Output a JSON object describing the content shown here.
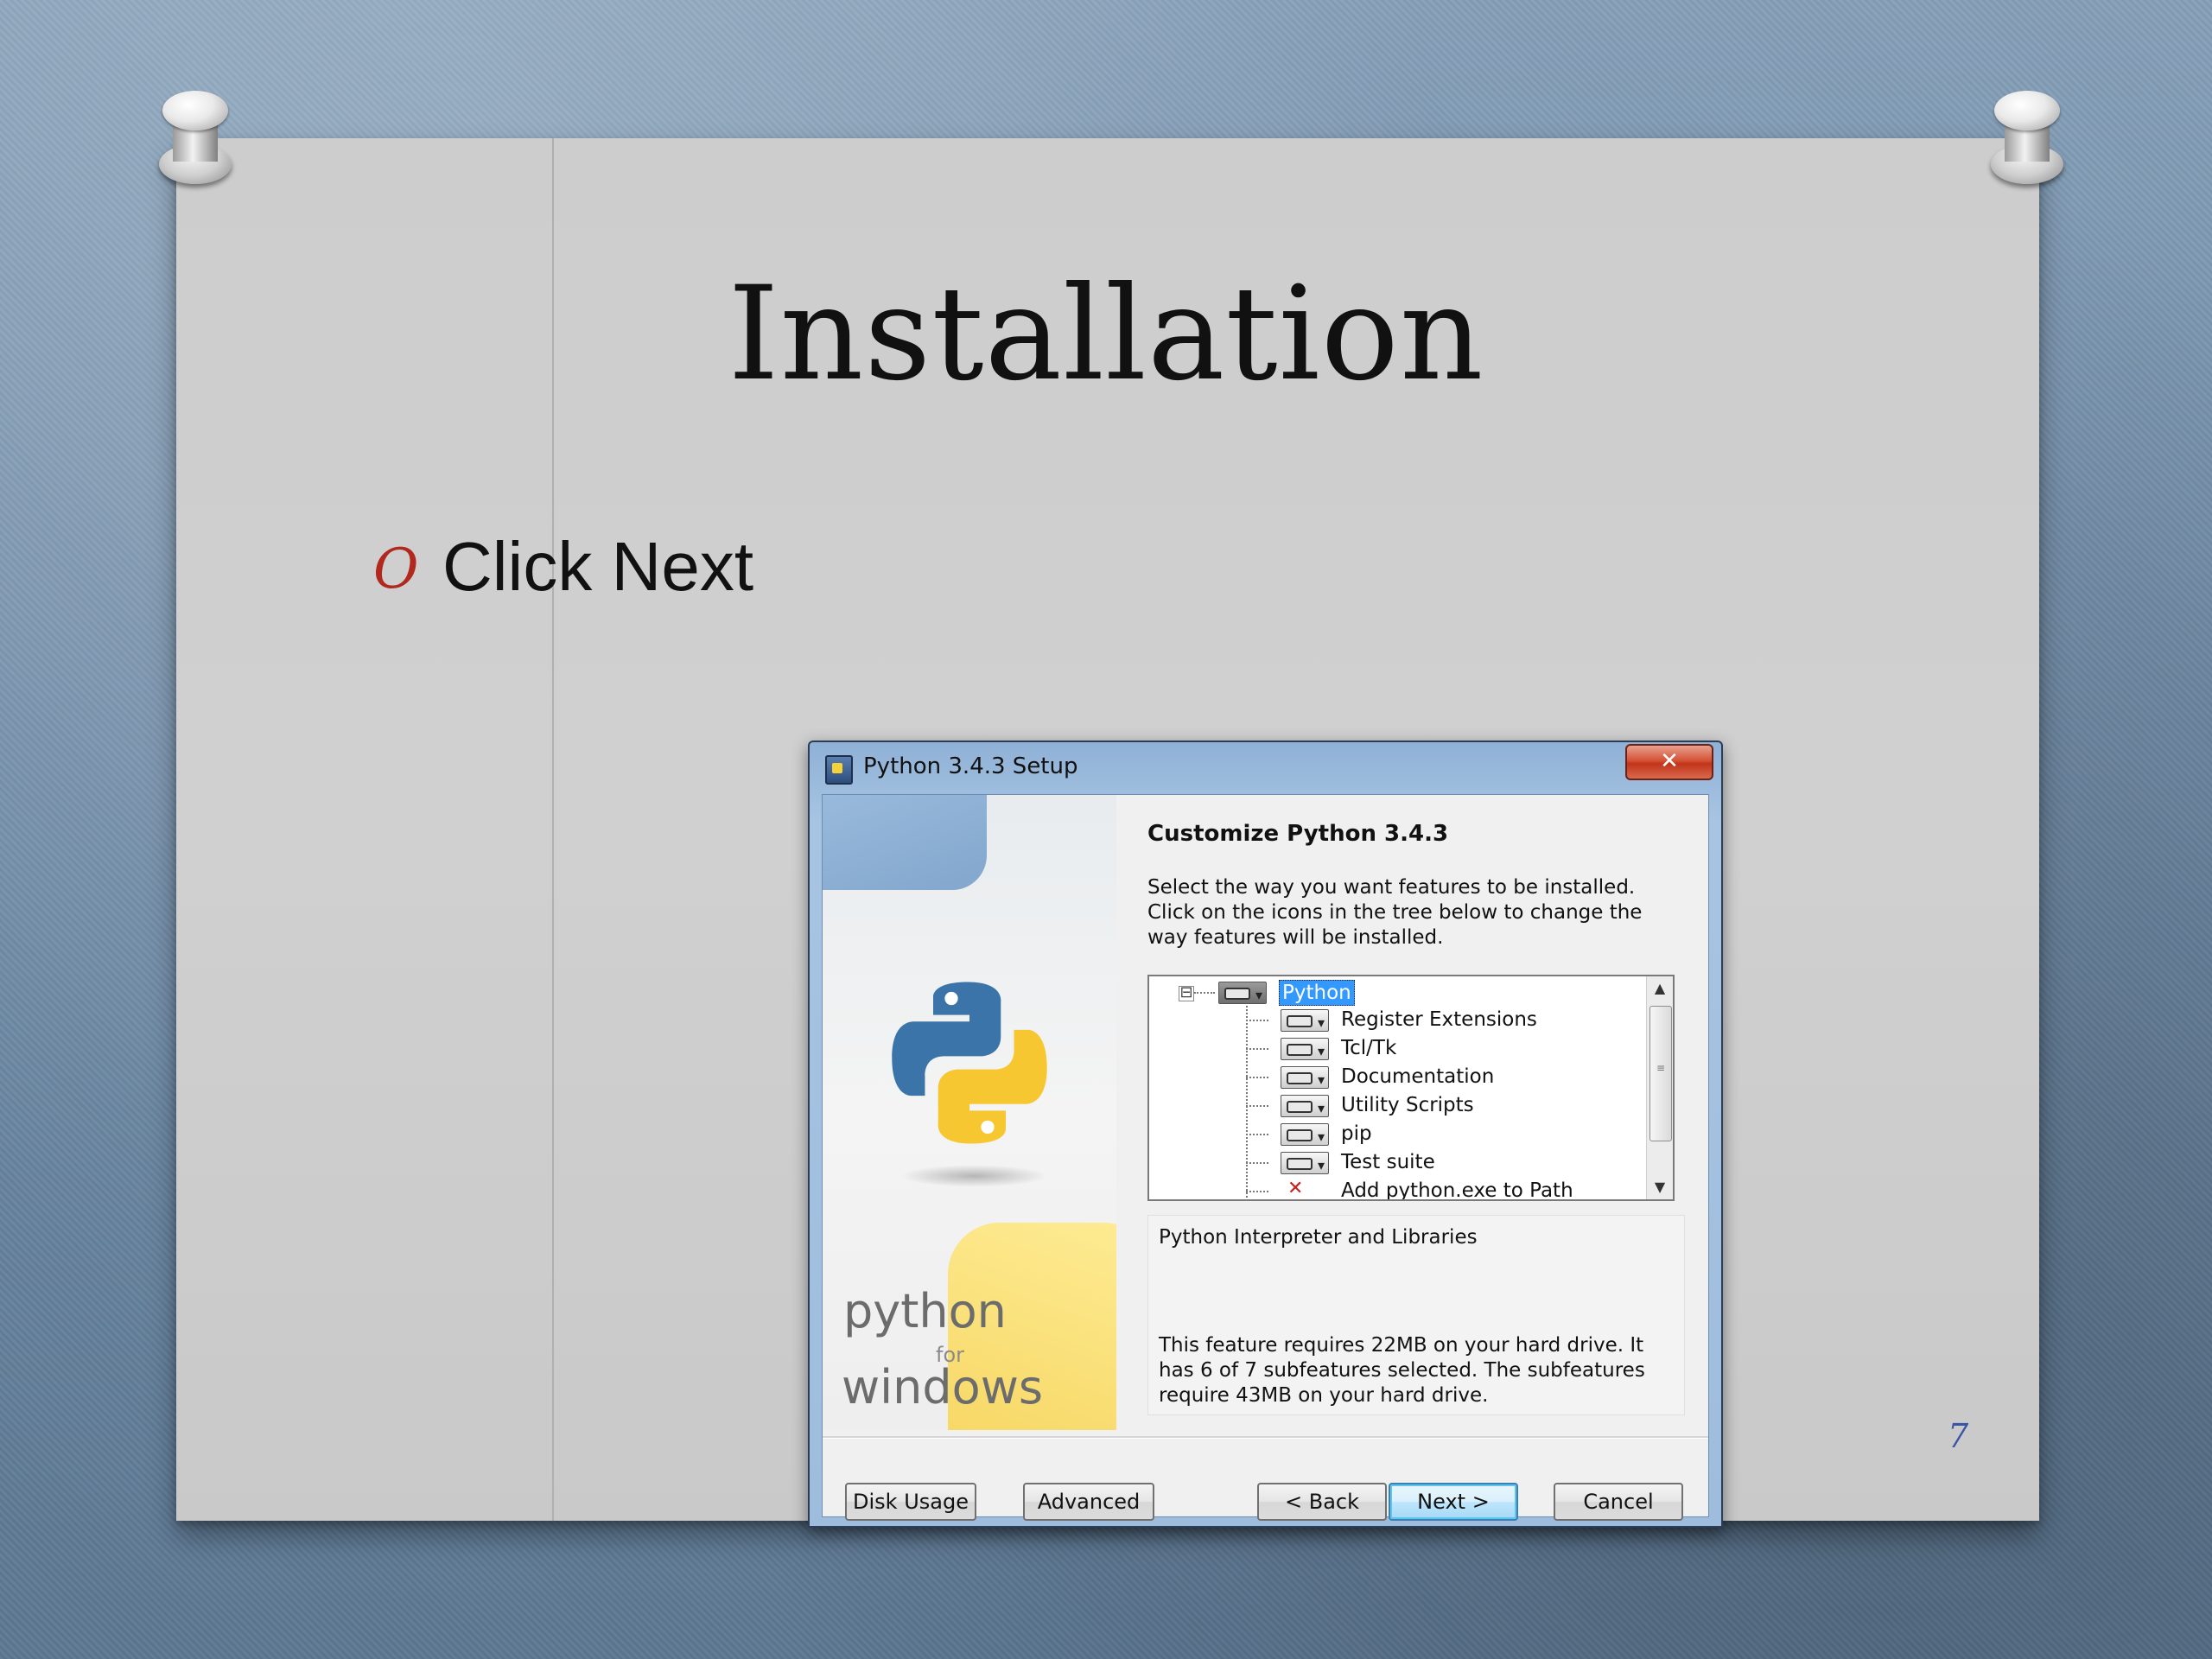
{
  "slide": {
    "title": "Installation",
    "bullet_marker": "O",
    "bullet": "Click Next",
    "page_number": "7"
  },
  "dialog": {
    "window_title": "Python 3.4.3 Setup",
    "close_label": "✕",
    "heading": "Customize Python 3.4.3",
    "instructions": [
      "Select the way you want features to be installed.",
      "Click on the icons in the tree below to change the",
      "way features will be installed."
    ],
    "banner": {
      "line1": "python",
      "line2": "for",
      "line3": "windows"
    },
    "tree": {
      "root": "Python",
      "expander": "⊟",
      "children": [
        "Register Extensions",
        "Tcl/Tk",
        "Documentation",
        "Utility Scripts",
        "pip",
        "Test suite",
        "Add python.exe to Path"
      ]
    },
    "description": {
      "title": "Python Interpreter and Libraries",
      "body": [
        "This feature requires 22MB on your hard drive. It",
        "has 6 of 7 subfeatures selected. The subfeatures",
        "require 43MB on your hard drive."
      ]
    },
    "buttons": {
      "disk_usage": "Disk Usage",
      "advanced": "Advanced",
      "back": "< Back",
      "next": "Next >",
      "cancel": "Cancel"
    }
  }
}
